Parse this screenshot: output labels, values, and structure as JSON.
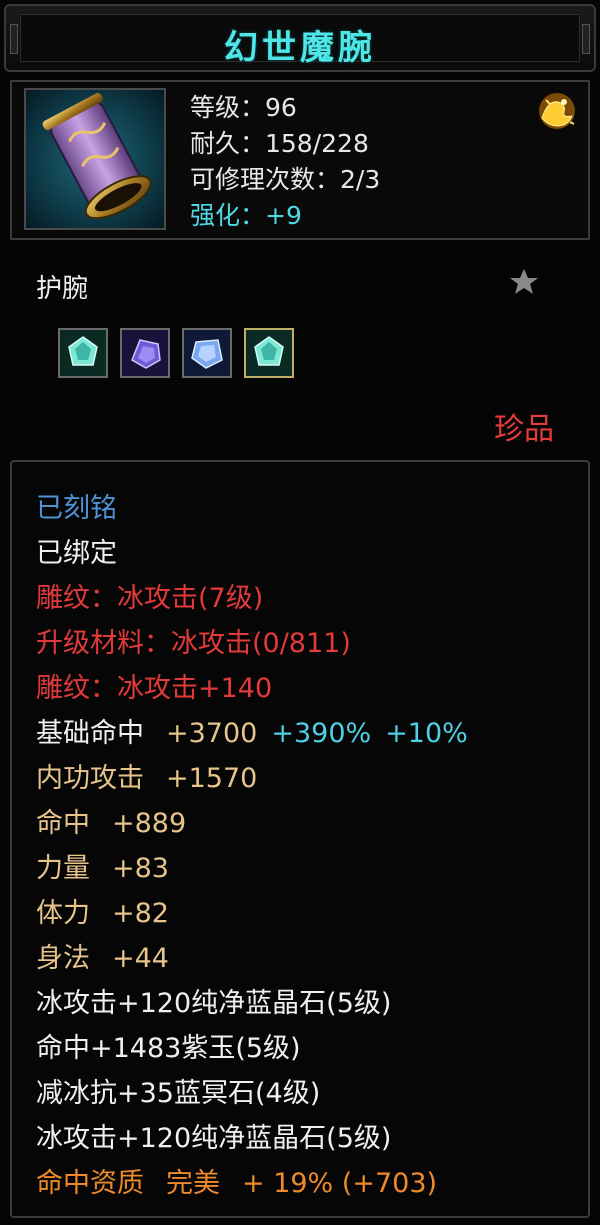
{
  "title": "幻世魔腕",
  "header": {
    "level_label": "等级：96",
    "durability_label": "耐久：158/228",
    "repair_label": "可修理次数：2/3",
    "enhance_label": "强化：+9",
    "icon": "bracer-item-icon",
    "badge_icon": "golden-dragon-rank-icon"
  },
  "type": {
    "label": "护腕",
    "star_icon": "star-icon",
    "gem_slots": [
      "cyan-gem-icon",
      "purple-gem-icon",
      "blue-gem-icon",
      "cyan-gem-icon"
    ],
    "rarity": "珍品"
  },
  "attributes": {
    "engraved": "已刻铭",
    "bound": "已绑定",
    "carving_1": "雕纹：冰攻击(7级)",
    "upgrade_material": "升级材料：冰攻击(0/811)",
    "carving_2": "雕纹：冰攻击+140",
    "base_hit_label": "基础命中",
    "base_hit_value": "+3700",
    "base_hit_pct1": "+390%",
    "base_hit_pct2": "+10%",
    "internal_attack_label": "内功攻击",
    "internal_attack_value": "+1570",
    "hit_label": "命中",
    "hit_value": "+889",
    "strength_label": "力量",
    "strength_value": "+83",
    "stamina_label": "体力",
    "stamina_value": "+82",
    "agility_label": "身法",
    "agility_value": "+44",
    "gem_1": "冰攻击+120纯净蓝晶石(5级)",
    "gem_2": "命中+1483紫玉(5级)",
    "gem_3": "减冰抗+35蓝冥石(4级)",
    "gem_4": "冰攻击+120纯净蓝晶石(5级)",
    "aptitude_label": "命中资质",
    "aptitude_grade": "完美",
    "aptitude_value": "+ 19% (+703)"
  },
  "colors": {
    "title": "#4ee6e6",
    "rarity": "#e63b3b",
    "engraved": "#4d93d4",
    "carving": "#e23a3a",
    "stat": "#e6c48a",
    "bonus": "#4fcfe6",
    "aptitude": "#ef8a2a"
  }
}
